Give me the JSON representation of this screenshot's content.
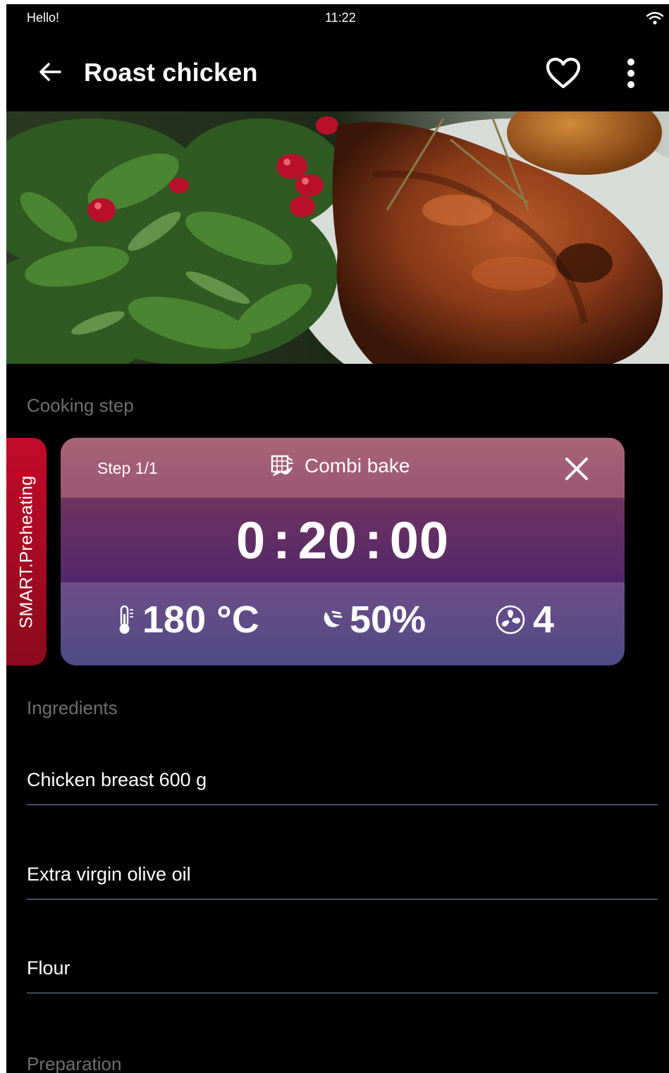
{
  "status_bar": {
    "greeting": "Hello!",
    "time": "11:22"
  },
  "header": {
    "title": "Roast chicken"
  },
  "cooking": {
    "section_label": "Cooking step",
    "smart_preheating_label": "SMART.Preheating",
    "step_label": "Step 1/1",
    "mode_label": "Combi bake",
    "timer": {
      "hours": "0",
      "minutes": "20",
      "seconds": "00"
    },
    "temperature": "180 °C",
    "humidity": "50%",
    "fan_level": "4"
  },
  "ingredients": {
    "section_label": "Ingredients",
    "items": [
      "Chicken breast 600 g",
      "Extra virgin olive oil",
      "Flour"
    ]
  },
  "preparation": {
    "section_label": "Preparation"
  },
  "colors": {
    "smart_tab": "#c30a2a",
    "card_top": "#a96478",
    "card_mid": "#5e2c66",
    "card_bottom": "#5a4c88",
    "divider": "#6d8fb8"
  }
}
